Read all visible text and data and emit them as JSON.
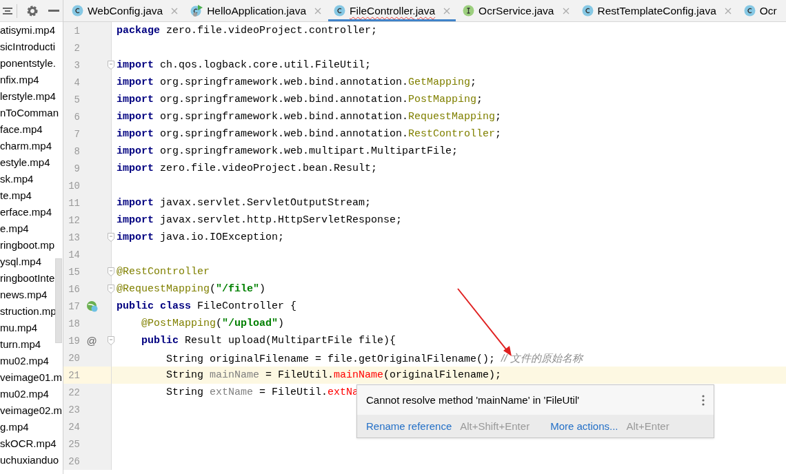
{
  "project_panel": {
    "files": [
      "atisymi.mp4",
      "sicIntroducti",
      "ponentstyle.",
      "nfix.mp4",
      "lerstyle.mp4",
      "nToComman",
      "face.mp4",
      "charm.mp4",
      "estyle.mp4",
      "sk.mp4",
      "te.mp4",
      "erface.mp4",
      "e.mp4",
      "ringboot.mp",
      "ysql.mp4",
      "ringbootInte",
      "news.mp4",
      "struction.mp",
      "mu.mp4",
      "turn.mp4",
      "mu02.mp4",
      "veimage01.m",
      "mu02.mp4",
      "veimage02.m",
      "g.mp4",
      "skOCR.mp4",
      "uchuxianduo"
    ]
  },
  "tabs": [
    {
      "label": "WebConfig.java",
      "kind": "class",
      "selected": false,
      "error": false
    },
    {
      "label": "HelloApplication.java",
      "kind": "app",
      "selected": false,
      "error": false
    },
    {
      "label": "FileController.java",
      "kind": "class",
      "selected": true,
      "error": true
    },
    {
      "label": "OcrService.java",
      "kind": "interface",
      "selected": false,
      "error": false
    },
    {
      "label": "RestTemplateConfig.java",
      "kind": "class",
      "selected": false,
      "error": false
    },
    {
      "label": "Ocr",
      "kind": "class",
      "selected": false,
      "error": false
    }
  ],
  "editor": {
    "lines": [
      {
        "number": "1",
        "kind": "plain",
        "current": false,
        "fold": false,
        "tokens": [
          {
            "kind": "kw",
            "text": "package"
          },
          {
            "kind": "plain",
            "text": " zero.file.videoProject.controller;"
          }
        ]
      },
      {
        "number": "2",
        "kind": "plain",
        "current": false,
        "fold": false
      },
      {
        "number": "3",
        "kind": "plain",
        "current": false,
        "fold": true,
        "tokens": [
          {
            "kind": "kw",
            "text": "import"
          },
          {
            "kind": "plain",
            "text": " ch.qos.logback.core.util.FileUtil;"
          }
        ]
      },
      {
        "number": "4",
        "kind": "plain",
        "current": false,
        "fold": false,
        "tokens": [
          {
            "kind": "kw",
            "text": "import"
          },
          {
            "kind": "plain",
            "text": " org.springframework.web.bind.annotation."
          },
          {
            "kind": "ann",
            "text": "GetMapping"
          },
          {
            "kind": "plain",
            "text": ";"
          }
        ]
      },
      {
        "number": "5",
        "kind": "plain",
        "current": false,
        "fold": false,
        "tokens": [
          {
            "kind": "kw",
            "text": "import"
          },
          {
            "kind": "plain",
            "text": " org.springframework.web.bind.annotation."
          },
          {
            "kind": "ann",
            "text": "PostMapping"
          },
          {
            "kind": "plain",
            "text": ";"
          }
        ]
      },
      {
        "number": "6",
        "kind": "plain",
        "current": false,
        "fold": false,
        "tokens": [
          {
            "kind": "kw",
            "text": "import"
          },
          {
            "kind": "plain",
            "text": " org.springframework.web.bind.annotation."
          },
          {
            "kind": "ann",
            "text": "RequestMapping"
          },
          {
            "kind": "plain",
            "text": ";"
          }
        ]
      },
      {
        "number": "7",
        "kind": "plain",
        "current": false,
        "fold": false,
        "tokens": [
          {
            "kind": "kw",
            "text": "import"
          },
          {
            "kind": "plain",
            "text": " org.springframework.web.bind.annotation."
          },
          {
            "kind": "ann",
            "text": "RestController"
          },
          {
            "kind": "plain",
            "text": ";"
          }
        ]
      },
      {
        "number": "8",
        "kind": "plain",
        "current": false,
        "fold": false,
        "tokens": [
          {
            "kind": "kw",
            "text": "import"
          },
          {
            "kind": "plain",
            "text": " org.springframework.web.multipart.MultipartFile;"
          }
        ]
      },
      {
        "number": "9",
        "kind": "plain",
        "current": false,
        "fold": false,
        "tokens": [
          {
            "kind": "kw",
            "text": "import"
          },
          {
            "kind": "plain",
            "text": " zero.file.videoProject.bean.Result;"
          }
        ]
      },
      {
        "number": "10",
        "kind": "plain",
        "current": false,
        "fold": false
      },
      {
        "number": "11",
        "kind": "plain",
        "current": false,
        "fold": false,
        "tokens": [
          {
            "kind": "kw",
            "text": "import"
          },
          {
            "kind": "plain",
            "text": " javax.servlet.ServletOutputStream;"
          }
        ]
      },
      {
        "number": "12",
        "kind": "plain",
        "current": false,
        "fold": false,
        "tokens": [
          {
            "kind": "kw",
            "text": "import"
          },
          {
            "kind": "plain",
            "text": " javax.servlet.http.HttpServletResponse;"
          }
        ]
      },
      {
        "number": "13",
        "kind": "plain",
        "current": false,
        "fold": true,
        "tokens": [
          {
            "kind": "kw",
            "text": "import"
          },
          {
            "kind": "plain",
            "text": " java.io.IOException;"
          }
        ]
      },
      {
        "number": "14",
        "kind": "plain",
        "current": false,
        "fold": false
      },
      {
        "number": "15",
        "kind": "plain",
        "current": false,
        "fold": true,
        "tokens": [
          {
            "kind": "ann",
            "text": "@RestController"
          }
        ]
      },
      {
        "number": "16",
        "kind": "plain",
        "current": false,
        "fold": true,
        "tokens": [
          {
            "kind": "ann",
            "text": "@RequestMapping"
          },
          {
            "kind": "plain",
            "text": "("
          },
          {
            "kind": "str",
            "text": "\"/file\""
          },
          {
            "kind": "plain",
            "text": ")"
          }
        ]
      },
      {
        "number": "17",
        "kind": "bean",
        "current": false,
        "fold": false,
        "tokens": [
          {
            "kind": "kw",
            "text": "public class"
          },
          {
            "kind": "plain",
            "text": " FileController {"
          }
        ]
      },
      {
        "number": "18",
        "kind": "plain",
        "current": false,
        "fold": false,
        "tokens": [
          {
            "kind": "ann",
            "text": "    @PostMapping"
          },
          {
            "kind": "plain",
            "text": "("
          },
          {
            "kind": "str",
            "text": "\"/upload\""
          },
          {
            "kind": "plain",
            "text": ")"
          }
        ]
      },
      {
        "number": "19",
        "kind": "plain",
        "current": false,
        "fold": true,
        "gutter_text": "@",
        "tokens": [
          {
            "kind": "kw",
            "text": "    public"
          },
          {
            "kind": "plain",
            "text": " Result upload(MultipartFile file){"
          }
        ]
      },
      {
        "number": "20",
        "kind": "plain",
        "current": false,
        "fold": false,
        "tokens": [
          {
            "kind": "plain",
            "text": "        String originalFilename = file.getOriginalFilename(); "
          },
          {
            "kind": "cmt",
            "text": "// 文件的原始名称"
          }
        ]
      },
      {
        "number": "21",
        "kind": "plain",
        "current": true,
        "fold": false,
        "tokens": [
          {
            "kind": "plain",
            "text": "        String "
          },
          {
            "kind": "unused",
            "text": "mainName"
          },
          {
            "kind": "plain",
            "text": " = FileUtil."
          },
          {
            "kind": "err",
            "text": "mainName"
          },
          {
            "kind": "plain",
            "text": "(originalFilename);"
          }
        ]
      },
      {
        "number": "22",
        "kind": "plain",
        "current": false,
        "fold": false,
        "tokens": [
          {
            "kind": "plain",
            "text": "        String "
          },
          {
            "kind": "unused",
            "text": "extName"
          },
          {
            "kind": "plain",
            "text": " = FileUtil."
          },
          {
            "kind": "err",
            "text": "extNa"
          }
        ]
      },
      {
        "number": "23",
        "kind": "plain",
        "current": false,
        "fold": false
      },
      {
        "number": "24",
        "kind": "plain",
        "current": false,
        "fold": false
      },
      {
        "number": "25",
        "kind": "plain",
        "current": false,
        "fold": false
      },
      {
        "number": "26",
        "kind": "plain",
        "current": false,
        "fold": false
      }
    ]
  },
  "error_popup": {
    "message": "Cannot resolve method 'mainName' in 'FileUtil'",
    "actions": [
      {
        "label": "Rename reference",
        "shortcut": "Alt+Shift+Enter"
      },
      {
        "label": "More actions...",
        "shortcut": "Alt+Enter"
      }
    ]
  }
}
